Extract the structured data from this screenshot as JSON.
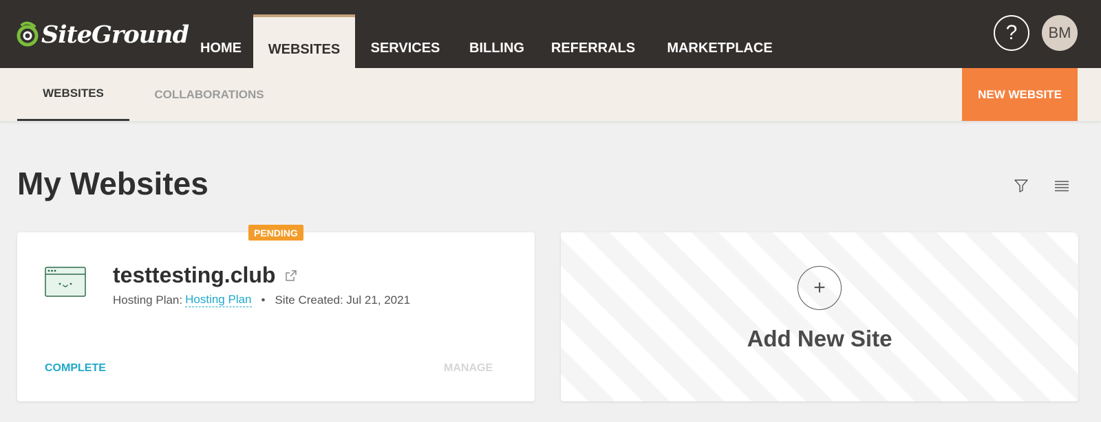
{
  "brand": {
    "name": "SiteGround",
    "accent": "#7cbd3b"
  },
  "topnav": {
    "tabs": [
      {
        "label": "HOME",
        "active": false
      },
      {
        "label": "WEBSITES",
        "active": true
      },
      {
        "label": "SERVICES",
        "active": false
      },
      {
        "label": "BILLING",
        "active": false
      },
      {
        "label": "REFERRALS",
        "active": false
      },
      {
        "label": "MARKETPLACE",
        "active": false
      }
    ],
    "help_label": "?",
    "avatar_initials": "BM"
  },
  "subnav": {
    "tabs": [
      {
        "label": "WEBSITES",
        "active": true
      },
      {
        "label": "COLLABORATIONS",
        "active": false
      }
    ],
    "new_website_label": "NEW WEBSITE"
  },
  "page": {
    "title": "My Websites"
  },
  "site_card": {
    "badge": "PENDING",
    "domain": "testtesting.club",
    "plan_label": "Hosting Plan:",
    "plan_value": "Hosting Plan",
    "separator": "•",
    "created_label": "Site Created: Jul 21, 2021",
    "complete_label": "COMPLETE",
    "manage_label": "MANAGE"
  },
  "add_card": {
    "plus": "+",
    "label": "Add New Site"
  },
  "colors": {
    "topbar": "#33302e",
    "subbar": "#f3efe8",
    "cta": "#f5813f",
    "badge": "#f39c2a",
    "link": "#1fa8c9"
  }
}
